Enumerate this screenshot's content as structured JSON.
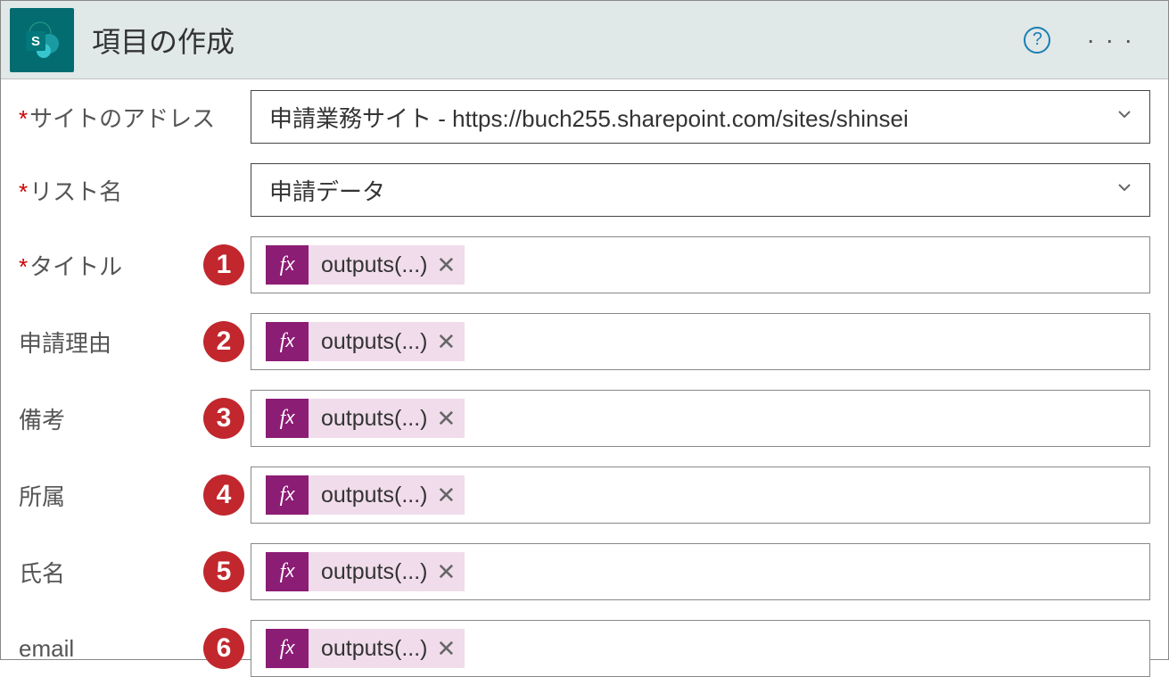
{
  "header": {
    "title": "項目の作成"
  },
  "fields": {
    "site_address": {
      "label": "サイトのアドレス",
      "value": "申請業務サイト - https://buch255.sharepoint.com/sites/shinsei"
    },
    "list_name": {
      "label": "リスト名",
      "value": "申請データ"
    },
    "title": {
      "label": "タイトル",
      "marker": "1",
      "token": "outputs(...)"
    },
    "reason": {
      "label": "申請理由",
      "marker": "2",
      "token": "outputs(...)"
    },
    "remarks": {
      "label": "備考",
      "marker": "3",
      "token": "outputs(...)"
    },
    "dept": {
      "label": "所属",
      "marker": "4",
      "token": "outputs(...)"
    },
    "name": {
      "label": "氏名",
      "marker": "5",
      "token": "outputs(...)"
    },
    "email": {
      "label": "email",
      "marker": "6",
      "token": "outputs(...)"
    }
  }
}
